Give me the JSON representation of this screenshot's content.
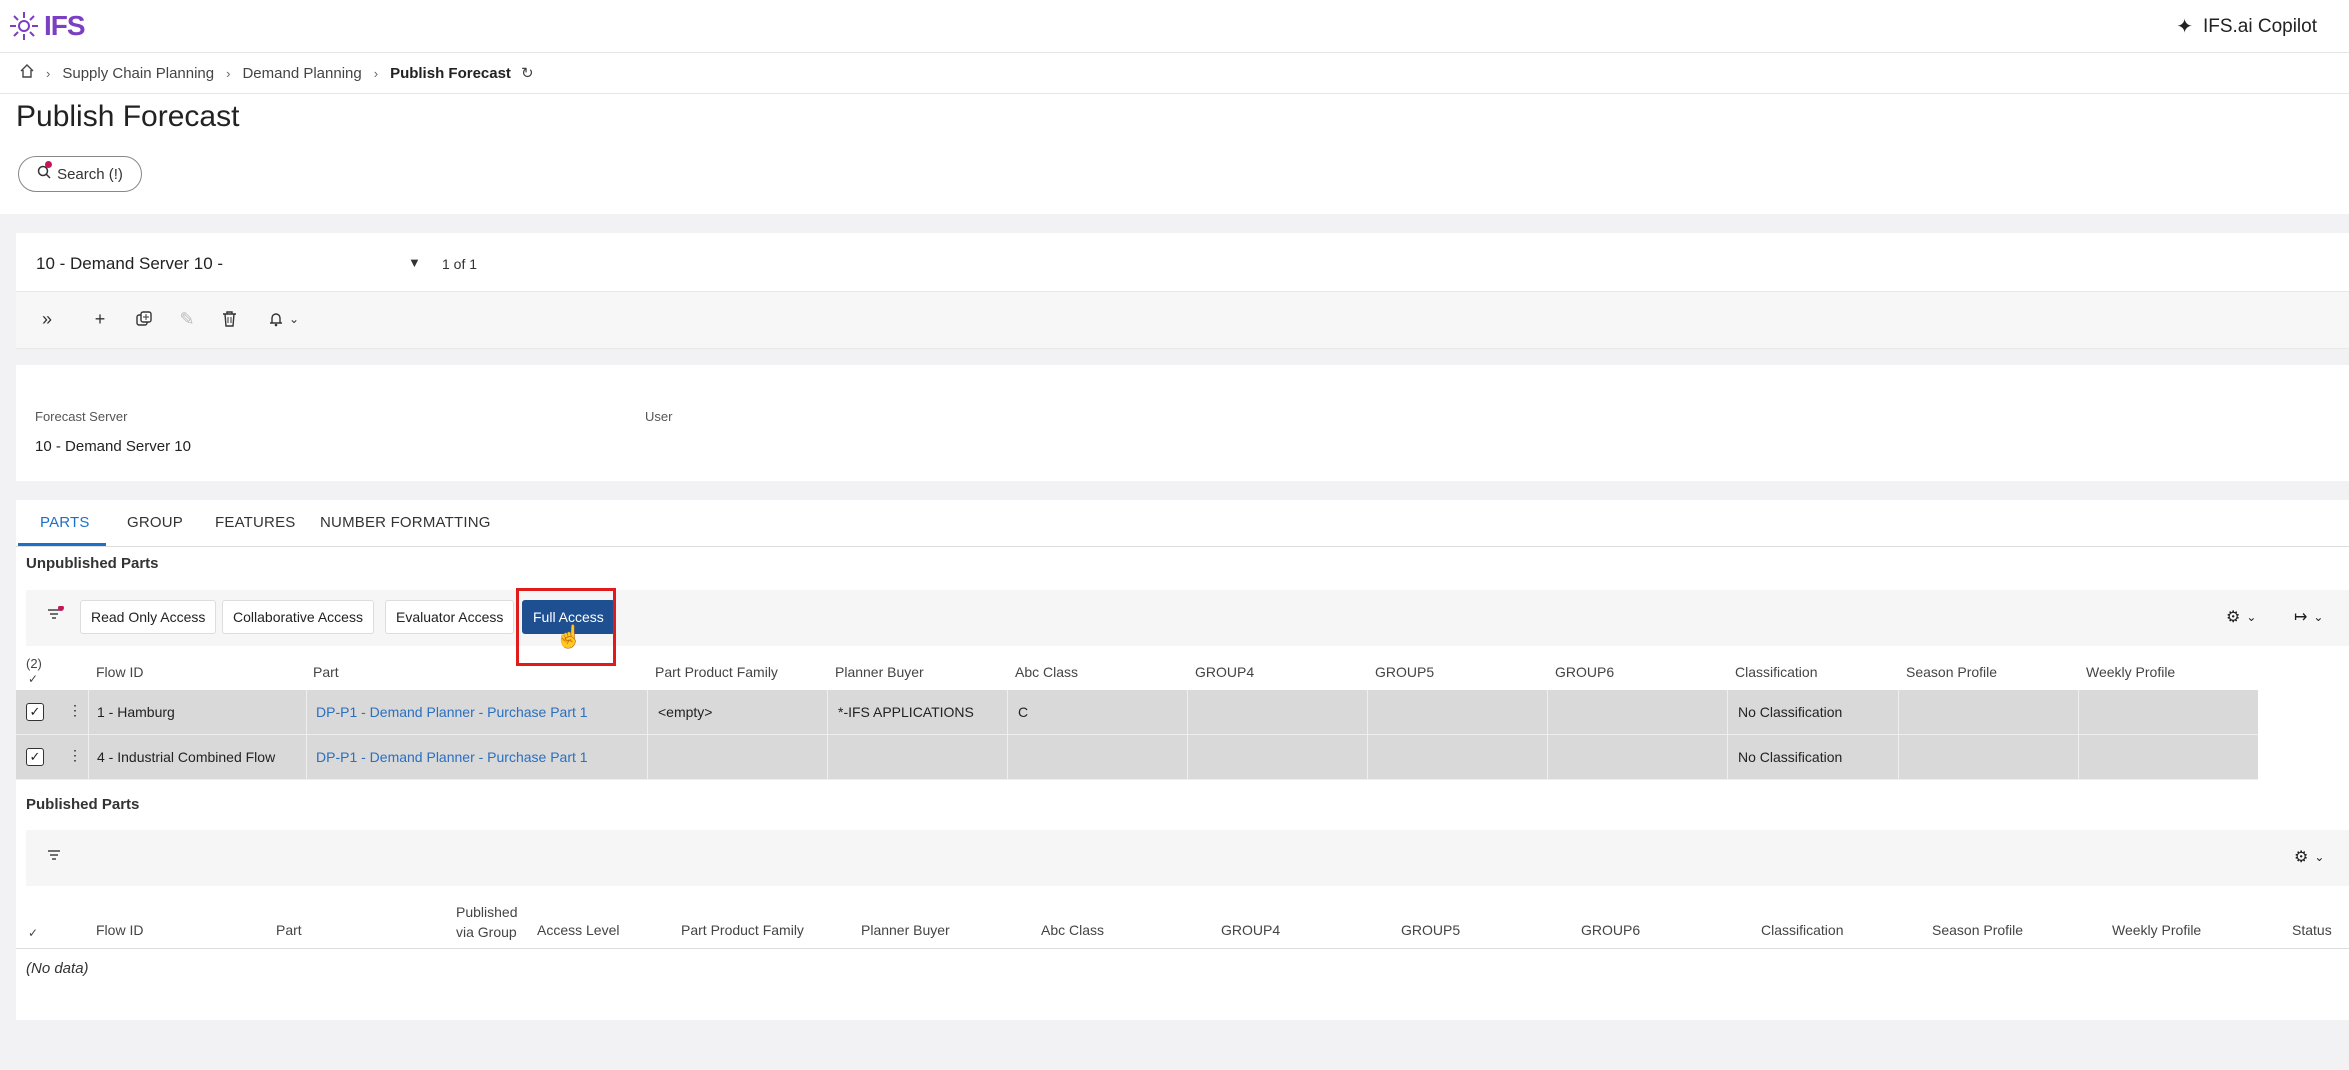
{
  "app": {
    "logo_text": "IFS",
    "copilot_label": "IFS.ai Copilot"
  },
  "breadcrumb": {
    "items": [
      "Supply Chain Planning",
      "Demand Planning",
      "Publish Forecast"
    ]
  },
  "page": {
    "title": "Publish Forecast",
    "search_label": "Search (!)"
  },
  "record_selector": {
    "value": "10 - Demand Server 10 -",
    "count": "1 of 1"
  },
  "details": {
    "forecast_server_label": "Forecast Server",
    "forecast_server_value": "10 - Demand Server 10",
    "user_label": "User"
  },
  "tabs": [
    "PARTS",
    "GROUP",
    "FEATURES",
    "NUMBER FORMATTING"
  ],
  "unpublished": {
    "title": "Unpublished Parts",
    "buttons": [
      "Read Only Access",
      "Collaborative Access",
      "Evaluator Access",
      "Full Access"
    ],
    "selected_count": "(2)",
    "columns": [
      "Flow ID",
      "Part",
      "Part Product Family",
      "Planner Buyer",
      "Abc Class",
      "GROUP4",
      "GROUP5",
      "GROUP6",
      "Classification",
      "Season Profile",
      "Weekly Profile"
    ],
    "rows": [
      {
        "flow_id": "1 - Hamburg",
        "part": "DP-P1 - Demand Planner - Purchase Part 1",
        "family": "<empty>",
        "planner": "*-IFS APPLICATIONS",
        "abc": "C",
        "classification": "No Classification"
      },
      {
        "flow_id": "4 - Industrial Combined Flow",
        "part": "DP-P1 - Demand Planner - Purchase Part 1",
        "family": "",
        "planner": "",
        "abc": "",
        "classification": "No Classification"
      }
    ]
  },
  "published": {
    "title": "Published Parts",
    "columns": [
      "Flow ID",
      "Part",
      "Published via Group",
      "Access Level",
      "Part Product Family",
      "Planner Buyer",
      "Abc Class",
      "GROUP4",
      "GROUP5",
      "GROUP6",
      "Classification",
      "Season Profile",
      "Weekly Profile",
      "Status"
    ],
    "empty_text": "(No data)"
  },
  "colors": {
    "accent": "#1e6fc8",
    "primary_button": "#1d4f91",
    "highlight": "#e01b1b",
    "brand": "#7b3fc4"
  }
}
